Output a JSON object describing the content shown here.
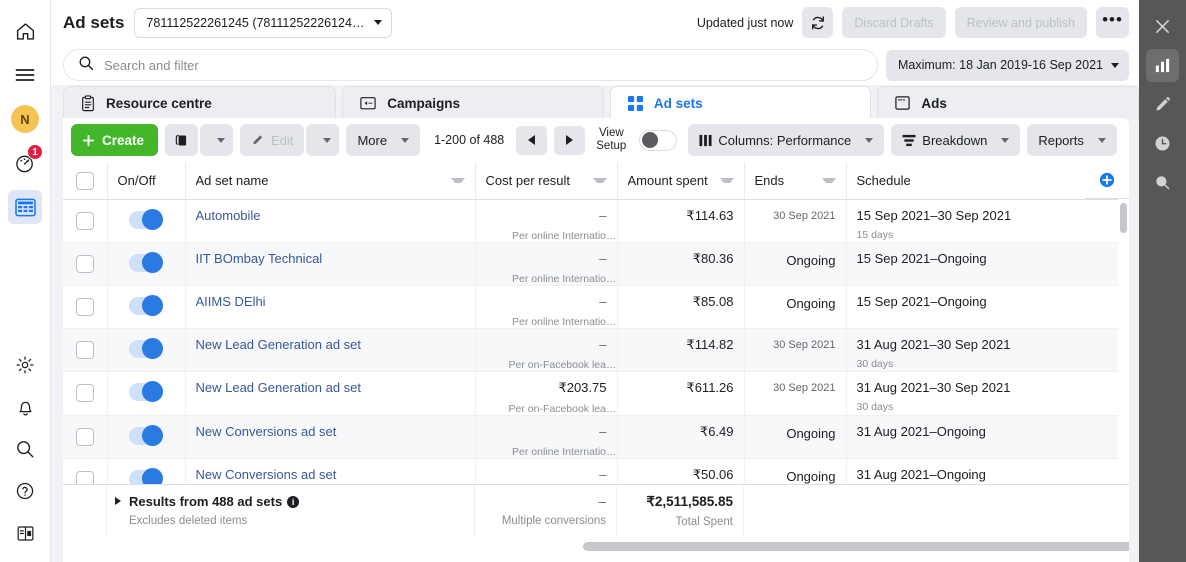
{
  "left_rail": {
    "items": [
      {
        "name": "home-icon",
        "label": "Home"
      },
      {
        "name": "menu-icon",
        "label": "Menu"
      },
      {
        "name": "avatar",
        "label": "N"
      },
      {
        "name": "notifications-icon",
        "label": "Notifications",
        "badge": "1"
      },
      {
        "name": "ads-manager-icon",
        "label": "Ads Manager"
      }
    ],
    "bottom_items": [
      {
        "name": "gear-icon",
        "label": "Settings"
      },
      {
        "name": "bell-icon",
        "label": "Alerts"
      },
      {
        "name": "search-icon",
        "label": "Search"
      },
      {
        "name": "help-icon",
        "label": "Help"
      },
      {
        "name": "panel-toggle-icon",
        "label": "Toggle panel"
      }
    ]
  },
  "top_bar": {
    "title": "Ad sets",
    "account": "781112522261245 (78111252226124…",
    "updated_text": "Updated just now",
    "refresh_label": "Refresh",
    "discard_label": "Discard Drafts",
    "review_label": "Review and publish",
    "more_label": "•••"
  },
  "search": {
    "placeholder": "Search and filter",
    "value": "",
    "date_range": "Maximum: 18 Jan 2019-16 Sep 2021"
  },
  "tabs": [
    {
      "label": "Resource centre",
      "icon": "clipboard-icon",
      "active": false
    },
    {
      "label": "Campaigns",
      "icon": "campaign-icon",
      "active": false
    },
    {
      "label": "Ad sets",
      "icon": "adsets-grid-icon",
      "active": true
    },
    {
      "label": "Ads",
      "icon": "ads-card-icon",
      "active": false
    }
  ],
  "toolbar": {
    "create_label": "Create",
    "duplicate_label": "Duplicate",
    "edit_label": "Edit",
    "more_label": "More",
    "pager_count": "1-200 of 488",
    "view_setup_line1": "View",
    "view_setup_line2": "Setup",
    "columns_label": "Columns: Performance",
    "breakdown_label": "Breakdown",
    "reports_label": "Reports"
  },
  "table": {
    "columns": [
      {
        "key": "checkbox",
        "label": ""
      },
      {
        "key": "onoff",
        "label": "On/Off"
      },
      {
        "key": "name",
        "label": "Ad set name"
      },
      {
        "key": "cost_per_result",
        "label": "Cost per result"
      },
      {
        "key": "amount_spent",
        "label": "Amount spent"
      },
      {
        "key": "ends",
        "label": "Ends"
      },
      {
        "key": "schedule",
        "label": "Schedule"
      }
    ],
    "rows": [
      {
        "name": "Automobile",
        "cost_per_result": "–",
        "cost_sub": "Per online Internatio…",
        "amount_spent": "₹114.63",
        "ends": "30 Sep 2021",
        "ends_small": true,
        "schedule": "15 Sep 2021–30 Sep 2021",
        "schedule_sub": "15 days"
      },
      {
        "name": "IIT BOmbay Technical",
        "cost_per_result": "–",
        "cost_sub": "Per online Internatio…",
        "amount_spent": "₹80.36",
        "ends": "Ongoing",
        "ends_small": false,
        "schedule": "15 Sep 2021–Ongoing",
        "schedule_sub": ""
      },
      {
        "name": "AIIMS DElhi",
        "cost_per_result": "–",
        "cost_sub": "Per online Internatio…",
        "amount_spent": "₹85.08",
        "ends": "Ongoing",
        "ends_small": false,
        "schedule": "15 Sep 2021–Ongoing",
        "schedule_sub": ""
      },
      {
        "name": "New Lead Generation ad set",
        "cost_per_result": "–",
        "cost_sub": "Per on-Facebook lea…",
        "amount_spent": "₹114.82",
        "ends": "30 Sep 2021",
        "ends_small": true,
        "schedule": "31 Aug 2021–30 Sep 2021",
        "schedule_sub": "30 days"
      },
      {
        "name": "New Lead Generation ad set",
        "cost_per_result": "₹203.75",
        "cost_sub": "Per on-Facebook lea…",
        "amount_spent": "₹611.26",
        "ends": "30 Sep 2021",
        "ends_small": true,
        "schedule": "31 Aug 2021–30 Sep 2021",
        "schedule_sub": "30 days"
      },
      {
        "name": "New Conversions ad set",
        "cost_per_result": "–",
        "cost_sub": "Per online Internatio…",
        "amount_spent": "₹6.49",
        "ends": "Ongoing",
        "ends_small": false,
        "schedule": "31 Aug 2021–Ongoing",
        "schedule_sub": ""
      },
      {
        "name": "New Conversions ad set",
        "cost_per_result": "–",
        "cost_sub": "",
        "amount_spent": "₹50.06",
        "ends": "Ongoing",
        "ends_small": false,
        "schedule": "31 Aug 2021–Ongoing",
        "schedule_sub": ""
      }
    ],
    "footer": {
      "title": "Results from 488 ad sets",
      "subtitle": "Excludes deleted items",
      "cost_per_result": "–",
      "cost_sub": "Multiple conversions",
      "amount_spent": "₹2,511,585.85",
      "amount_sub": "Total Spent"
    }
  },
  "right_rail": {
    "items": [
      {
        "name": "close-icon",
        "label": "Close",
        "active": false
      },
      {
        "name": "bar-chart-icon",
        "label": "Charts",
        "active": true
      },
      {
        "name": "pencil-icon",
        "label": "Edit",
        "active": false
      },
      {
        "name": "clock-icon",
        "label": "History",
        "active": false
      },
      {
        "name": "zoom-icon",
        "label": "Inspect",
        "active": false
      }
    ]
  },
  "colors": {
    "accent_blue": "#1877f2",
    "link_blue": "#385898",
    "create_green": "#42b72a",
    "badge_red": "#e41e3f",
    "avatar_yellow": "#f5c452",
    "toggle_blue": "#2a7ae4"
  }
}
